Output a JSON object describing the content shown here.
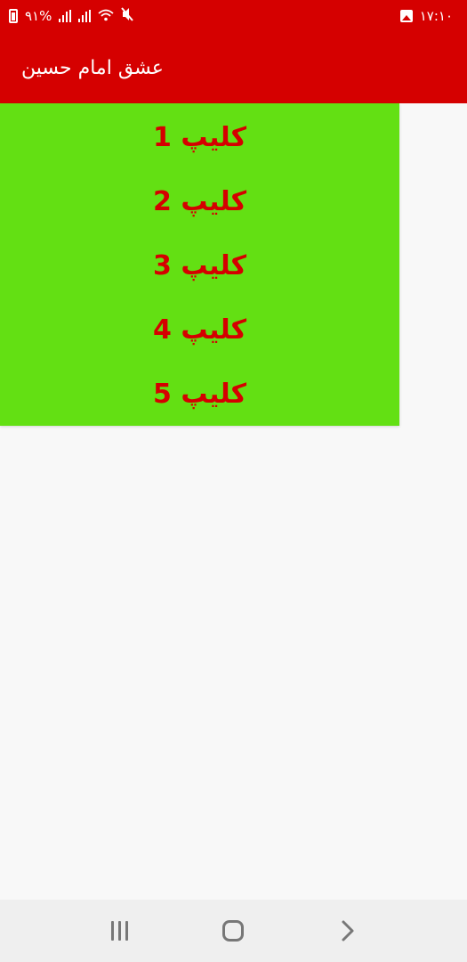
{
  "status_bar": {
    "battery_text": "۹۱%",
    "time": "۱۷:۱۰"
  },
  "app_bar": {
    "title": "عشق امام حسین"
  },
  "clips": [
    {
      "label": "کلیپ 1"
    },
    {
      "label": "کلیپ 2"
    },
    {
      "label": "کلیپ 3"
    },
    {
      "label": "کلیپ 4"
    },
    {
      "label": "کلیپ 5"
    }
  ],
  "colors": {
    "primary": "#d50000",
    "list_background": "#63e013",
    "page_background": "#f8f8f8",
    "nav_background": "#efefef"
  },
  "icons": {
    "status": [
      "battery-icon",
      "signal-icon",
      "wifi-icon",
      "mute-icon",
      "gallery-icon"
    ],
    "nav": [
      "recents-icon",
      "home-icon",
      "back-icon"
    ]
  }
}
